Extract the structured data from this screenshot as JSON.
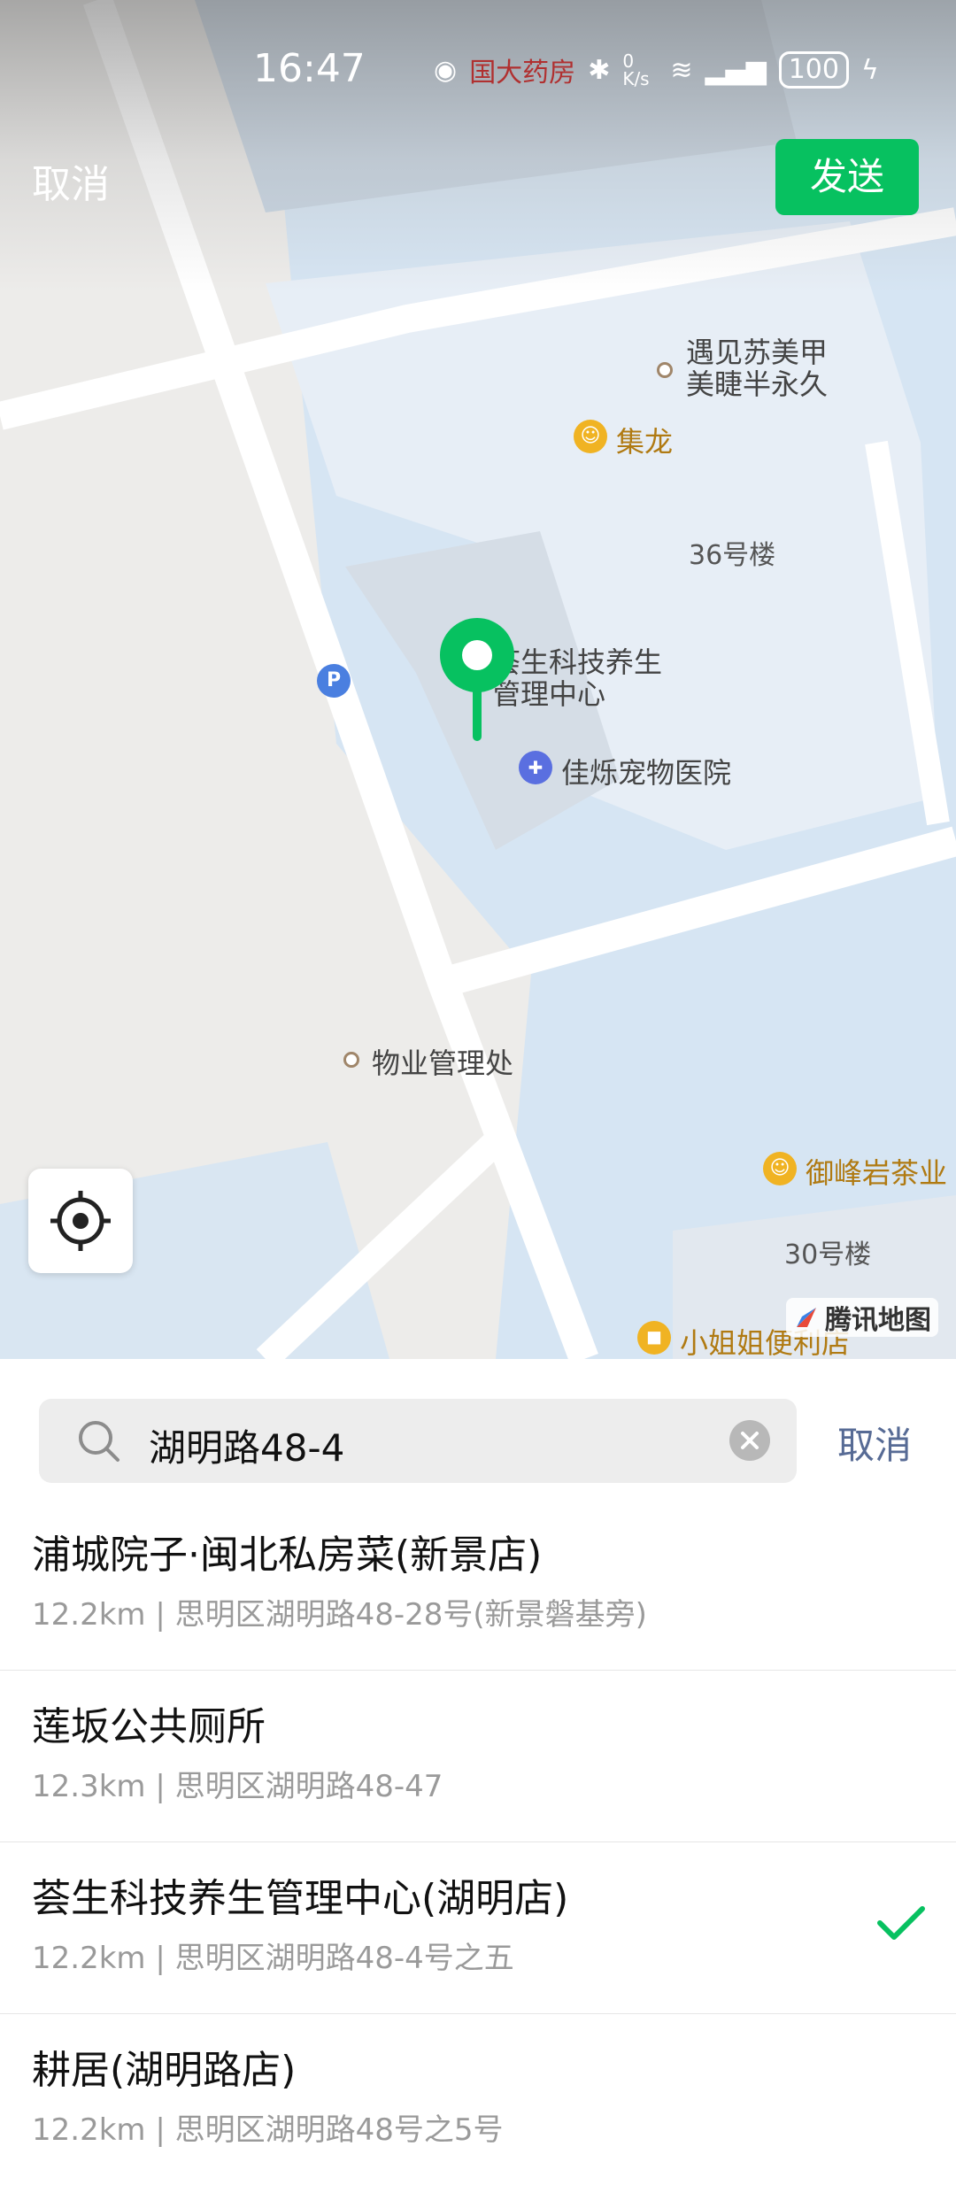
{
  "status_bar": {
    "time": "16:47",
    "network_speed": "0 K/s",
    "battery": "100",
    "carrier_text": "国大药房"
  },
  "top_bar": {
    "cancel_label": "取消",
    "send_label": "发送"
  },
  "map": {
    "poi_labels": {
      "yujian": [
        "遇见苏美甲",
        "美睫半永久"
      ],
      "jilong": "集龙",
      "building36": "36号楼",
      "huisheng": [
        "荟生科技养生",
        "管理中心"
      ],
      "pet_hospital": "佳烁宠物医院",
      "property": "物业管理处",
      "tea": "御峰岩茶业",
      "building30": "30号楼",
      "store": "小姐姐便利店"
    },
    "parking_symbol": "P",
    "provider_logo": "腾讯地图",
    "accent_color": "#07c160"
  },
  "search": {
    "value": "湖明路48-4",
    "cancel_label": "取消"
  },
  "results": [
    {
      "name": "浦城院子·闽北私房菜(新景店)",
      "address": "12.2km | 思明区湖明路48-28号(新景磐基旁)",
      "selected": false
    },
    {
      "name": "莲坂公共厕所",
      "address": "12.3km | 思明区湖明路48-47",
      "selected": false
    },
    {
      "name": "荟生科技养生管理中心(湖明店)",
      "address": "12.2km | 思明区湖明路48-4号之五",
      "selected": true
    },
    {
      "name": "耕居(湖明路店)",
      "address": "12.2km | 思明区湖明路48号之5号",
      "selected": false
    }
  ]
}
